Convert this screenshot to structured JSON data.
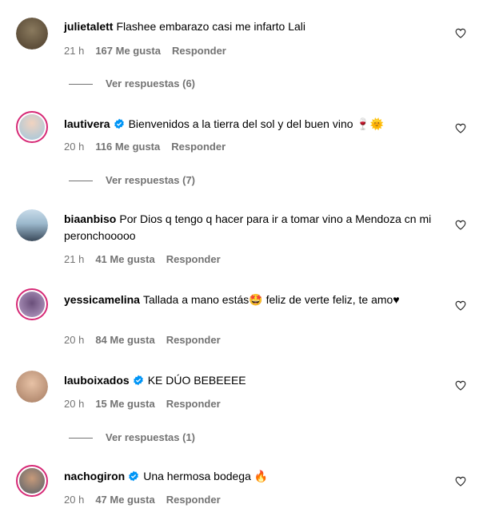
{
  "comments": [
    {
      "username": "julietalett",
      "verified": false,
      "text": "Flashee embarazo casi me infarto Lali",
      "time": "21 h",
      "likes": "167 Me gusta",
      "reply": "Responder",
      "view_replies": "Ver respuestas (6)"
    },
    {
      "username": "lautivera",
      "verified": true,
      "text": "Bienvenidos a la tierra del sol y del buen vino 🍷🌞",
      "time": "20 h",
      "likes": "116 Me gusta",
      "reply": "Responder",
      "view_replies": "Ver respuestas (7)"
    },
    {
      "username": "biaanbiso",
      "verified": false,
      "text": "Por Dios q tengo q hacer para ir a tomar vino a Mendoza cn mi peronchooooo",
      "time": "21 h",
      "likes": "41 Me gusta",
      "reply": "Responder"
    },
    {
      "username": "yessicamelina",
      "verified": false,
      "text": "Tallada a mano estás🤩 feliz de verte feliz, te amo♥",
      "time": "20 h",
      "likes": "84 Me gusta",
      "reply": "Responder"
    },
    {
      "username": "lauboixados",
      "verified": true,
      "text": "KE DÚO BEBEEEE",
      "time": "20 h",
      "likes": "15 Me gusta",
      "reply": "Responder",
      "view_replies": "Ver respuestas (1)"
    },
    {
      "username": "nachogiron",
      "verified": true,
      "text": "Una hermosa bodega 🔥",
      "time": "20 h",
      "likes": "47 Me gusta",
      "reply": "Responder"
    }
  ],
  "colors": {
    "verified": "#0095f6",
    "secondary_text": "#737373",
    "story_ring": "#d62976"
  }
}
